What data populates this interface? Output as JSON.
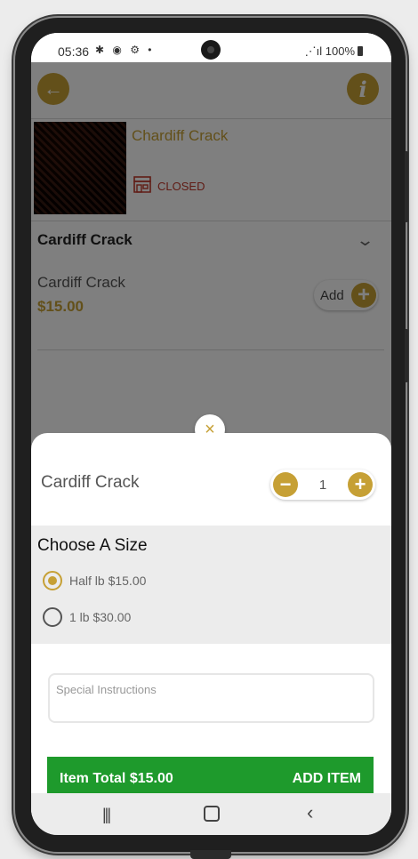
{
  "status_bar": {
    "time": "05:36",
    "left_icons": "✱ ◉ ⚙ •",
    "signal_battery": "100%"
  },
  "store": {
    "name": "Chardiff Crack",
    "status": "CLOSED"
  },
  "menu": {
    "section_title": "Cardiff Crack",
    "item": {
      "name": "Cardiff Crack",
      "price": "$15.00",
      "add_label": "Add"
    }
  },
  "sheet": {
    "close_glyph": "×",
    "title": "Cardiff Crack",
    "quantity": "1",
    "minus_glyph": "−",
    "plus_glyph": "+",
    "size_section_title": "Choose A Size",
    "size_options": [
      {
        "label": "Half lb $15.00",
        "selected": true
      },
      {
        "label": "1 lb $30.00",
        "selected": false
      }
    ],
    "instructions_placeholder": "Special Instructions",
    "item_total": "Item Total $15.00",
    "add_item_label": "ADD ITEM"
  },
  "colors": {
    "accent_gold": "#c6a035",
    "add_item_green": "#1e9a2c",
    "closed_red": "#c0392b"
  },
  "icons": {
    "back": "arrow-left-icon",
    "info": "info-icon",
    "store_closed": "storefront-icon",
    "chevron": "chevron-down-icon",
    "close": "close-icon"
  }
}
